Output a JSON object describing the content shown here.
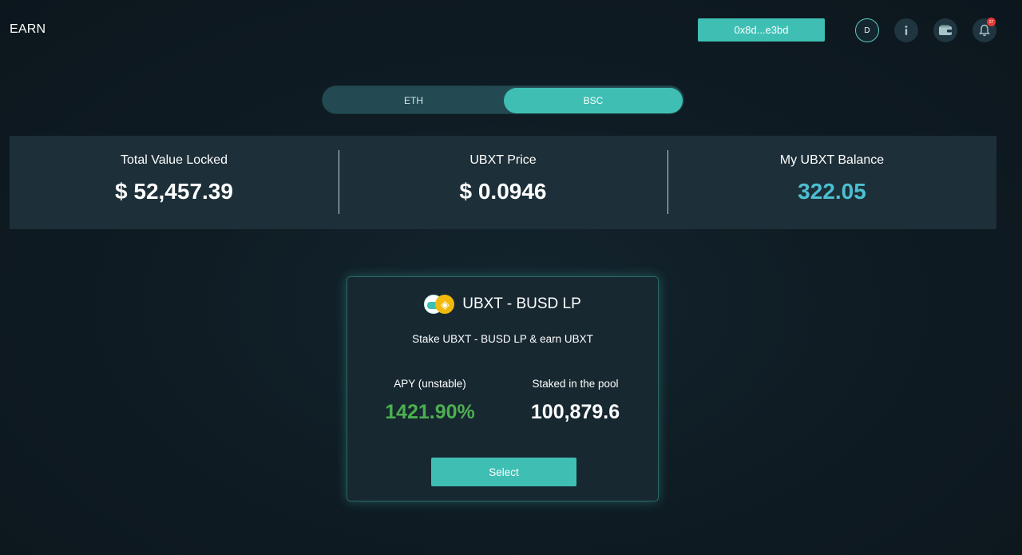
{
  "page": {
    "title": "EARN"
  },
  "header": {
    "wallet_address": "0x8d...e3bd",
    "avatar_initial": "D",
    "notification_count": "27",
    "icons": [
      "info-icon",
      "wallet-icon",
      "bell-icon"
    ]
  },
  "network_tabs": {
    "items": [
      {
        "label": "ETH",
        "active": false
      },
      {
        "label": "BSC",
        "active": true
      }
    ]
  },
  "stats": {
    "total_value_locked": {
      "label": "Total Value Locked",
      "value": "$ 52,457.39"
    },
    "ubxt_price": {
      "label": "UBXT Price",
      "value": "$ 0.0946"
    },
    "my_balance": {
      "label": "My UBXT Balance",
      "value": "322.05"
    }
  },
  "pool": {
    "title": "UBXT - BUSD LP",
    "description": "Stake UBXT - BUSD LP & earn UBXT",
    "apy_label": "APY (unstable)",
    "apy_value": "1421.90%",
    "staked_label": "Staked in the pool",
    "staked_value": "100,879.6",
    "select_label": "Select"
  },
  "colors": {
    "accent": "#3fbfb4",
    "balance": "#4cbfd0",
    "apy_green": "#4caf50",
    "badge_red": "#e53935",
    "busd_yellow": "#f0b90b"
  }
}
